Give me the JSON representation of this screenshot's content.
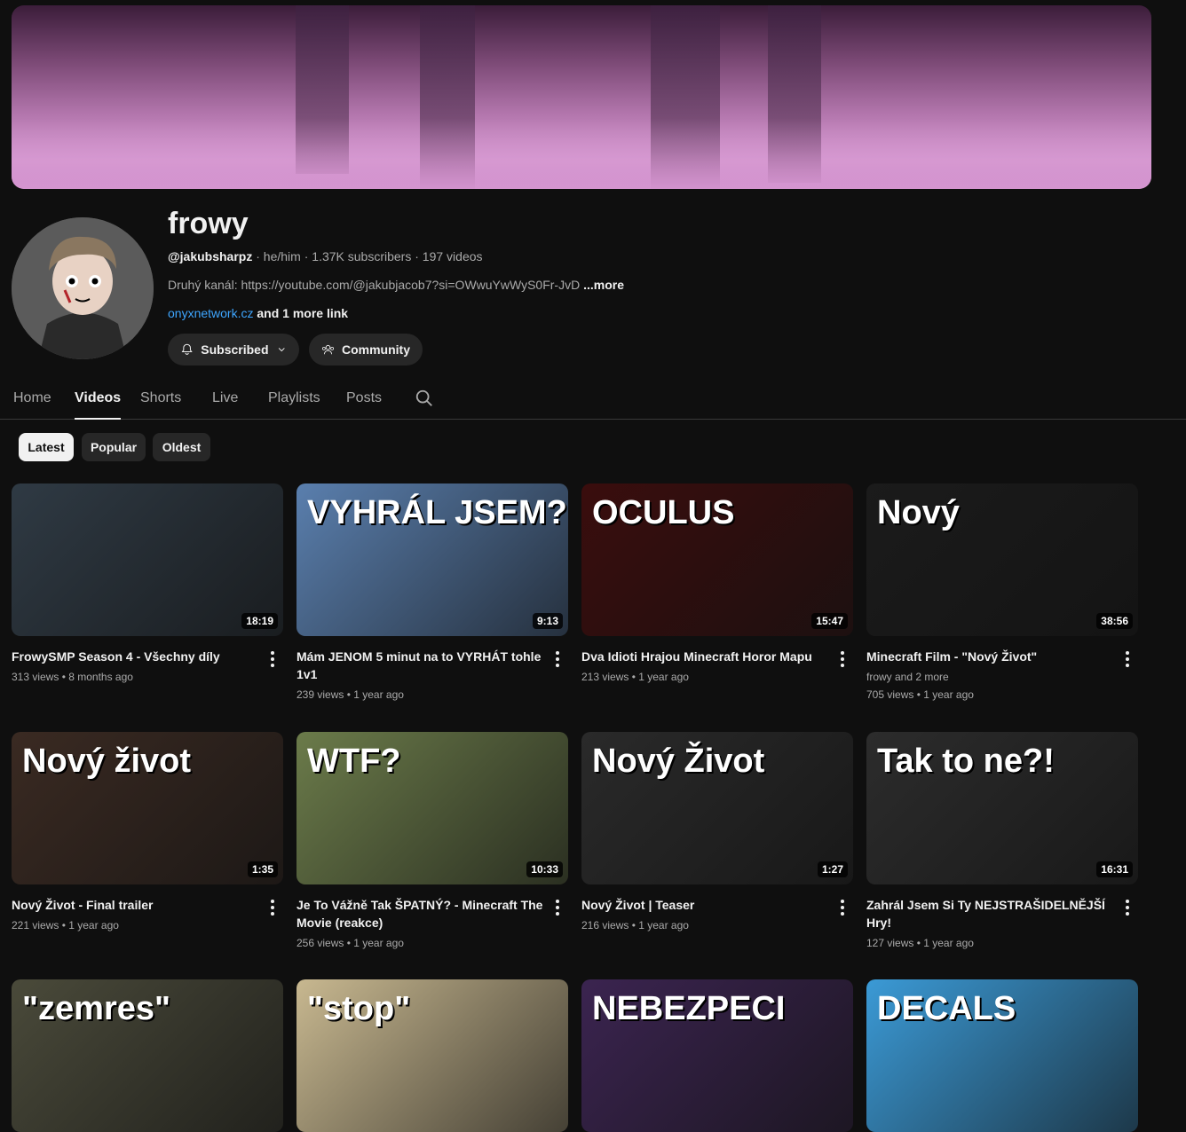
{
  "channel": {
    "name": "frowy",
    "handle": "@jakubsharpz",
    "pronouns": "he/him",
    "subscribers": "1.37K subscribers",
    "video_count": "197 videos",
    "description": "Druhý kanál: https://youtube.com/@jakubjacob7?si=OWwuYwWyS0Fr-JvD",
    "more_label": "...more",
    "link": "onyxnetwork.cz",
    "more_links": "and 1 more link",
    "subscribed_label": "Subscribed",
    "community_label": "Community"
  },
  "tabs": [
    {
      "label": "Home"
    },
    {
      "label": "Videos"
    },
    {
      "label": "Shorts"
    },
    {
      "label": "Live"
    },
    {
      "label": "Playlists"
    },
    {
      "label": "Posts"
    }
  ],
  "active_tab": "Videos",
  "chips": [
    {
      "label": "Latest"
    },
    {
      "label": "Popular"
    },
    {
      "label": "Oldest"
    }
  ],
  "videos": [
    {
      "title": "FrowySMP Season 4 - Všechny díly",
      "line1": "313 views • 8 months ago",
      "line2": "",
      "duration": "18:19",
      "overlay": ""
    },
    {
      "title": "Mám JENOM 5 minut na to VYRHÁT tohle 1v1",
      "line1": "239 views • 1 year ago",
      "line2": "",
      "duration": "9:13",
      "overlay": "VYHRÁL JSEM?"
    },
    {
      "title": "Dva Idioti Hrajou Minecraft Horor Mapu",
      "line1": "213 views • 1 year ago",
      "line2": "",
      "duration": "15:47",
      "overlay": "OCULUS"
    },
    {
      "title": "Minecraft Film - \"Nový Život\"",
      "line1": "frowy and 2 more",
      "line2": "705 views • 1 year ago",
      "duration": "38:56",
      "overlay": "Nový"
    },
    {
      "title": "Nový Život - Final trailer",
      "line1": "221 views • 1 year ago",
      "line2": "",
      "duration": "1:35",
      "overlay": "Nový život"
    },
    {
      "title": "Je To Vážně Tak ŠPATNÝ? - Minecraft The Movie (reakce)",
      "line1": "256 views • 1 year ago",
      "line2": "",
      "duration": "10:33",
      "overlay": "WTF?"
    },
    {
      "title": "Nový Život | Teaser",
      "line1": "216 views • 1 year ago",
      "line2": "",
      "duration": "1:27",
      "overlay": "Nový Život"
    },
    {
      "title": "Zahrál Jsem Si Ty NEJSTRAŠIDELNĚJŠÍ Hry!",
      "line1": "127 views • 1 year ago",
      "line2": "",
      "duration": "16:31",
      "overlay": "Tak to ne?!"
    },
    {
      "title": "",
      "line1": "",
      "line2": "",
      "duration": "",
      "overlay": "\"zemres\""
    },
    {
      "title": "",
      "line1": "",
      "line2": "",
      "duration": "",
      "overlay": "\"stop\""
    },
    {
      "title": "",
      "line1": "",
      "line2": "",
      "duration": "",
      "overlay": "NEBEZPECI"
    },
    {
      "title": "",
      "line1": "",
      "line2": "",
      "duration": "",
      "overlay": "DECALS"
    }
  ],
  "thumb_colors": [
    "#2f3a44",
    "#5a7fae",
    "#3a0d0d",
    "#1b1b1b",
    "#3a2a22",
    "#6b7b4a",
    "#2a2a2a",
    "#2c2c2c",
    "#4a4a3a",
    "#c8b890",
    "#3b2450",
    "#3b9ad6"
  ]
}
